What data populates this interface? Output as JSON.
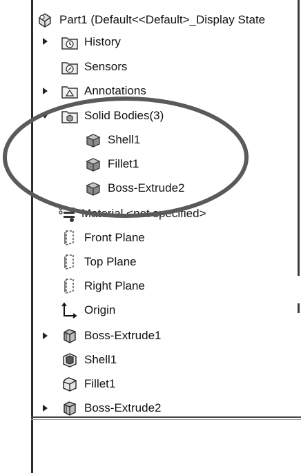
{
  "tree": {
    "root": {
      "label": "Part1  (Default<<Default>_Display State",
      "icon": "part-icon"
    },
    "items": [
      {
        "label": "History",
        "icon": "history-folder-icon",
        "expandable": true
      },
      {
        "label": "Sensors",
        "icon": "sensors-folder-icon",
        "expandable": false
      },
      {
        "label": "Annotations",
        "icon": "annotations-folder-icon",
        "expandable": true
      },
      {
        "label": "Solid Bodies(3)",
        "icon": "solid-bodies-folder-icon",
        "expandable": true,
        "expanded": true
      },
      {
        "label": "Shell1",
        "icon": "solid-body-icon"
      },
      {
        "label": "Fillet1",
        "icon": "solid-body-icon"
      },
      {
        "label": "Boss-Extrude2",
        "icon": "solid-body-icon"
      },
      {
        "label": "Material <not specified>",
        "icon": "material-icon"
      },
      {
        "label": "Front Plane",
        "icon": "plane-icon"
      },
      {
        "label": "Top Plane",
        "icon": "plane-icon"
      },
      {
        "label": "Right Plane",
        "icon": "plane-icon"
      },
      {
        "label": "Origin",
        "icon": "origin-icon"
      },
      {
        "label": "Boss-Extrude1",
        "icon": "boss-extrude-icon",
        "expandable": true
      },
      {
        "label": "Shell1",
        "icon": "shell-feature-icon"
      },
      {
        "label": "Fillet1",
        "icon": "fillet-feature-icon"
      },
      {
        "label": "Boss-Extrude2",
        "icon": "boss-extrude-icon",
        "expandable": true
      }
    ]
  },
  "annotation": {
    "shape": "ellipse",
    "color": "#555555",
    "encloses": "Solid Bodies(3)"
  }
}
